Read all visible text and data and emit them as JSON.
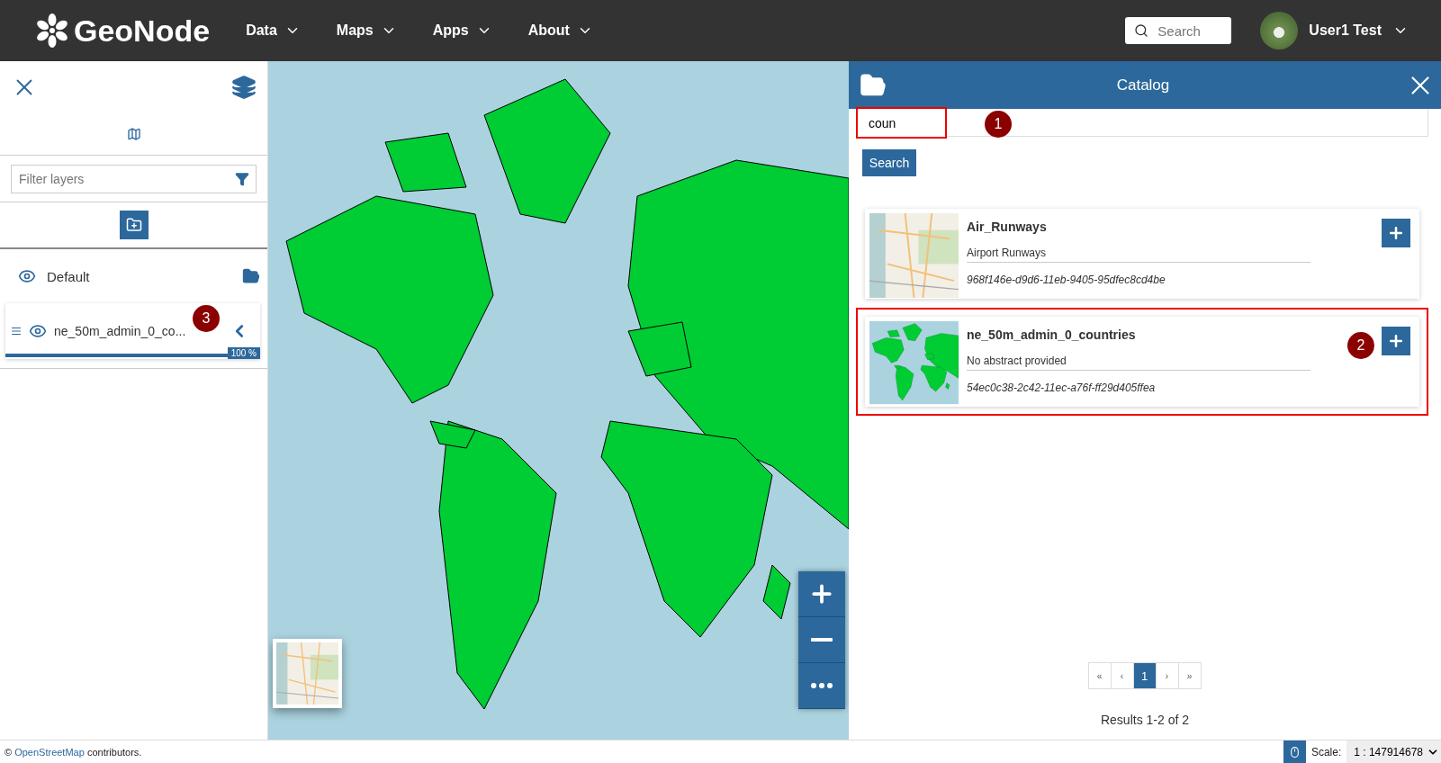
{
  "navbar": {
    "logo": "GeoNode",
    "menus": [
      {
        "label": "Data"
      },
      {
        "label": "Maps"
      },
      {
        "label": "Apps"
      },
      {
        "label": "About"
      }
    ],
    "search": {
      "placeholder": "Search"
    },
    "user": {
      "name": "User1 Test"
    }
  },
  "layers_panel": {
    "filter": {
      "placeholder": "Filter layers"
    },
    "groups": [
      {
        "title": "Default",
        "visible": true,
        "children": [
          {
            "title": "ne_50m_admin_0_co...",
            "visible": true,
            "level": 1,
            "opacity_label": "100 %",
            "annotation": "3"
          }
        ]
      }
    ]
  },
  "catalog": {
    "title": "Catalog",
    "search": {
      "value": "coun",
      "highlighted": true,
      "annotation": "1"
    },
    "search_button": "Search",
    "results": [
      {
        "title": "Air_Runways",
        "abstract": "Airport Runways",
        "id": "968f146e-d9d6-11eb-9405-95dfec8cd4be",
        "highlighted": false
      },
      {
        "title": "ne_50m_admin_0_countries",
        "abstract": "No abstract provided",
        "id": "54ec0c38-2c42-11ec-a76f-ff29d405ffea",
        "highlighted": true,
        "annotation": "2"
      }
    ],
    "pagination": [
      {
        "label": "«",
        "selected": false
      },
      {
        "label": "‹",
        "selected": false
      },
      {
        "label": "1",
        "selected": true
      },
      {
        "label": "›",
        "selected": false
      },
      {
        "label": "»",
        "selected": false
      }
    ],
    "summary": "Results 1-2 of 2"
  },
  "footer": {
    "attribution_prefix": "©",
    "attribution_link": "OpenStreetMap",
    "attribution_suffix": "contributors.",
    "scale_label": "Scale:",
    "scale_value": "1 : 147914678"
  }
}
